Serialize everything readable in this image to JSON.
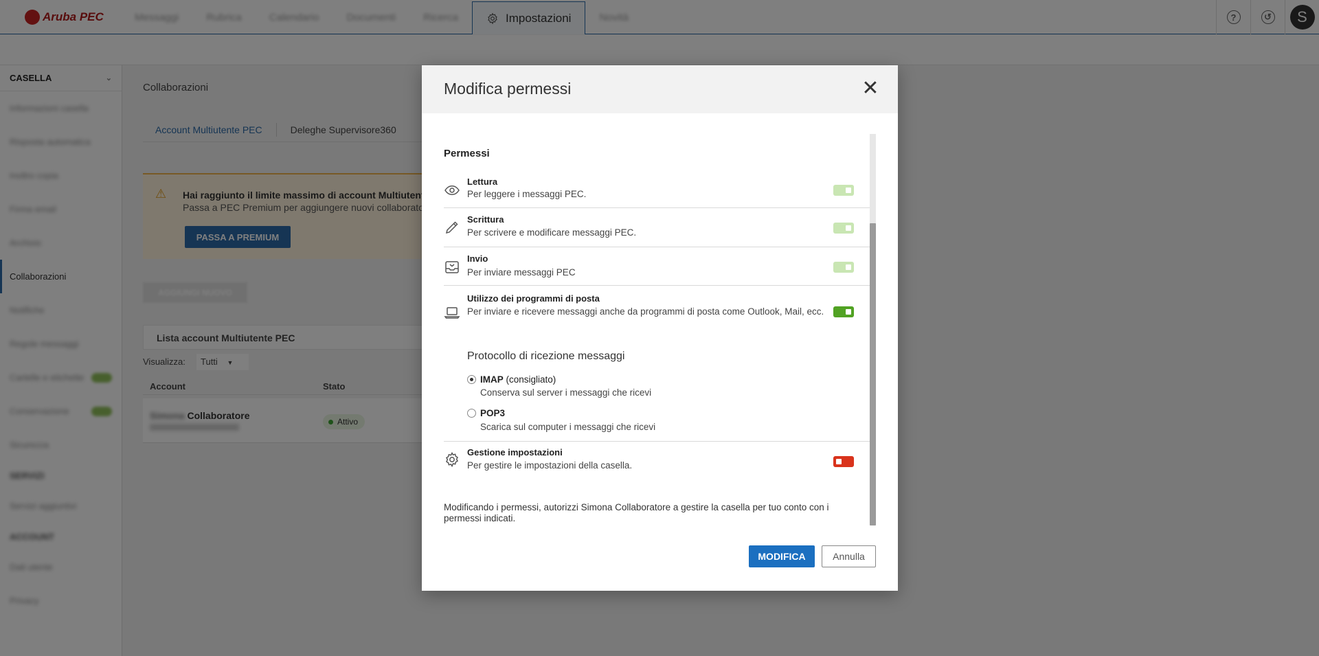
{
  "app": {
    "logo_text": "Aruba PEC",
    "nav_active_label": "Impostazioni",
    "nav_blurred": [
      "Messaggi",
      "Rubrica",
      "Calendario",
      "Documenti",
      "Ricerca",
      "Novità"
    ],
    "avatar_letter": "S",
    "help_glyph": "?",
    "history_glyph": "↺"
  },
  "sidebar": {
    "header": "CASELLA",
    "items": [
      {
        "label": "Informazioni casella",
        "state": "blur"
      },
      {
        "label": "Risposta automatica",
        "state": "blur"
      },
      {
        "label": "Inoltro copia",
        "state": "blur"
      },
      {
        "label": "Firma email",
        "state": "blur"
      },
      {
        "label": "Archivio",
        "state": "blur"
      },
      {
        "label": "Collaborazioni",
        "state": "active"
      },
      {
        "label": "Notifiche",
        "state": "blur"
      },
      {
        "label": "Regole messaggi",
        "state": "blur"
      },
      {
        "label": "Cartelle e etichette",
        "state": "blur"
      },
      {
        "label": "Conservazione",
        "state": "blur"
      },
      {
        "label": "Sicurezza",
        "state": "blur"
      },
      {
        "label": "SERVIZI",
        "state": "dark"
      },
      {
        "label": "Servizi aggiuntivi",
        "state": "blur"
      },
      {
        "label": "ACCOUNT",
        "state": "dark"
      },
      {
        "label": "Dati utente",
        "state": "blur"
      },
      {
        "label": "Privacy",
        "state": "blur"
      }
    ]
  },
  "main": {
    "title": "Collaborazioni",
    "tabs": [
      "Account Multiutente PEC",
      "Deleghe Supervisore360"
    ],
    "alert_title": "Hai raggiunto il limite massimo di account Multiutente",
    "alert_text": "Passa a PEC Premium per aggiungere nuovi collaboratori",
    "premium_button": "PASSA A PREMIUM",
    "add_button": "AGGIUNGI NUOVO",
    "list_title": "Lista account Multiutente PEC",
    "filter_label": "Visualizza:",
    "filter_value": "Tutti",
    "columns": [
      "Account",
      "Stato"
    ],
    "row": {
      "name_blurred": "Simona",
      "name": "Collaboratore",
      "status": "Attivo"
    }
  },
  "modal": {
    "title": "Modifica permessi",
    "close_glyph": "✕",
    "section_title": "Permessi",
    "permissions": [
      {
        "name": "Lettura",
        "desc": "Per leggere i messaggi PEC.",
        "icon": "eye-icon",
        "toggle": "on-disabled"
      },
      {
        "name": "Scrittura",
        "desc": "Per scrivere e modificare messaggi PEC.",
        "icon": "pencil-icon",
        "toggle": "on-disabled"
      },
      {
        "name": "Invio",
        "desc": "Per inviare messaggi PEC",
        "icon": "send-tray-icon",
        "toggle": "on-disabled"
      },
      {
        "name": "Utilizzo dei programmi di posta",
        "desc": "Per inviare e ricevere messaggi anche da programmi di posta come Outlook, Mail, ecc.",
        "icon": "laptop-icon",
        "toggle": "on"
      },
      {
        "name": "Gestione impostazioni",
        "desc": "Per gestire le impostazioni della casella.",
        "icon": "gear-icon",
        "toggle": "off"
      }
    ],
    "protocol_title": "Protocollo di ricezione messaggi",
    "protocols": [
      {
        "name": "IMAP",
        "note": "(consigliato)",
        "desc": "Conserva sul server i messaggi che ricevi",
        "checked": true
      },
      {
        "name": "POP3",
        "note": "",
        "desc": "Scarica sul computer i messaggi che ricevi",
        "checked": false
      }
    ],
    "footnote": "Modificando i permessi, autorizzi Simona Collaboratore a gestire la casella per tuo conto con i permessi indicati.",
    "confirm_button": "MODIFICA",
    "cancel_button": "Annulla"
  }
}
